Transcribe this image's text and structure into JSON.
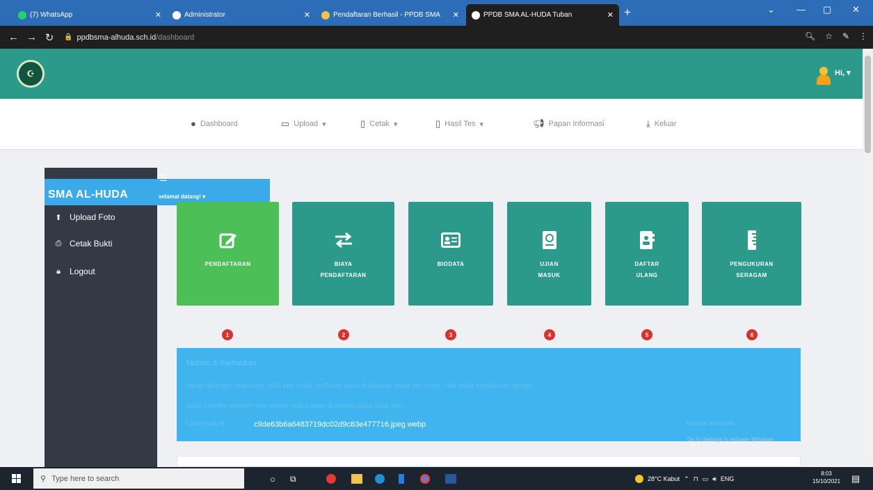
{
  "browser": {
    "tabs": [
      {
        "title": "(7) WhatsApp",
        "icon": "whatsapp-icon",
        "color": "#25d366"
      },
      {
        "title": "Administrator",
        "icon": "globe-icon",
        "color": "#ffffff"
      },
      {
        "title": "Pendaftaran Berhasil - PPDB SMA",
        "icon": "school-logo-icon",
        "color": "#f5c23e"
      },
      {
        "title": "PPDB SMA AL-HUDA Tuban",
        "icon": "globe-icon",
        "color": "#ffffff"
      }
    ],
    "active_tab": 3,
    "url_host": "ppdbsma-alhuda.sch.id",
    "url_path": "/dashboard"
  },
  "header": {
    "user_greeting": "Hi, "
  },
  "topnav": [
    {
      "label": "Dashboard",
      "icon": "tint-icon"
    },
    {
      "label": "Upload",
      "icon": "window-icon",
      "dropdown": true
    },
    {
      "label": "Cetak",
      "icon": "file-icon",
      "dropdown": true
    },
    {
      "label": "Hasil Tes",
      "icon": "mobile-icon",
      "dropdown": true
    },
    {
      "label": "Papan Informasi",
      "icon": "bullhorn-icon"
    },
    {
      "label": "Keluar",
      "icon": "download-icon"
    }
  ],
  "sidebar": {
    "brand": "SMA AL-HUDA",
    "welcome": "selamat datang!",
    "items": [
      {
        "label": "Upload Foto",
        "icon": "upload-icon"
      },
      {
        "label": "Cetak Bukti",
        "icon": "print-icon"
      },
      {
        "label": "Logout",
        "icon": "lock-icon"
      }
    ]
  },
  "cards": [
    {
      "label": "PENDAFTARAN",
      "icon": "edit-icon",
      "step": "1",
      "color": "#4cbf57"
    },
    {
      "label": "BIAYA\nPENDAFTARAN",
      "icon": "exchange-icon",
      "step": "2",
      "color": "#2b9a8b"
    },
    {
      "label": "BIODATA",
      "icon": "id-card-icon",
      "step": "3",
      "color": "#2b9a8b"
    },
    {
      "label": "UJIAN\nMASUK",
      "icon": "passport-icon",
      "step": "4",
      "color": "#2b9a8b"
    },
    {
      "label": "DAFTAR\nULANG",
      "icon": "address-book-icon",
      "step": "5",
      "color": "#2b9a8b"
    },
    {
      "label": "PENGUKURAN\nSERAGAM",
      "icon": "ruler-icon",
      "step": "6",
      "color": "#2b9a8b"
    }
  ],
  "info": {
    "title": "Mohon di Perhatikan",
    "line1": "harap ditunggu maksimal 1x24 jam untuk verifikasi akun di lakukan pada jam kerja. Jika anda melakukan upload",
    "line2": "bukti transfer melebihi jam kantor maka akan di proses pada esok hari.",
    "file_prefix": "Lihat bukti tf :",
    "file_name": "c9de63b6a6483719dc02d9c83e477716.jpeg.webp",
    "watermark": "Activate Windows",
    "watermark_sub": "Go to Settings to activate Windows."
  },
  "taskbar": {
    "search_placeholder": "Type here to search",
    "weather": "28°C  Kabut",
    "lang": "ENG",
    "time": "8:03",
    "date": "15/10/2021"
  },
  "colors": {
    "teal": "#2b9a8b",
    "green": "#4cbf57",
    "blue": "#3fb4ef",
    "sidebar": "#343a45",
    "step_red": "#d9312c"
  }
}
